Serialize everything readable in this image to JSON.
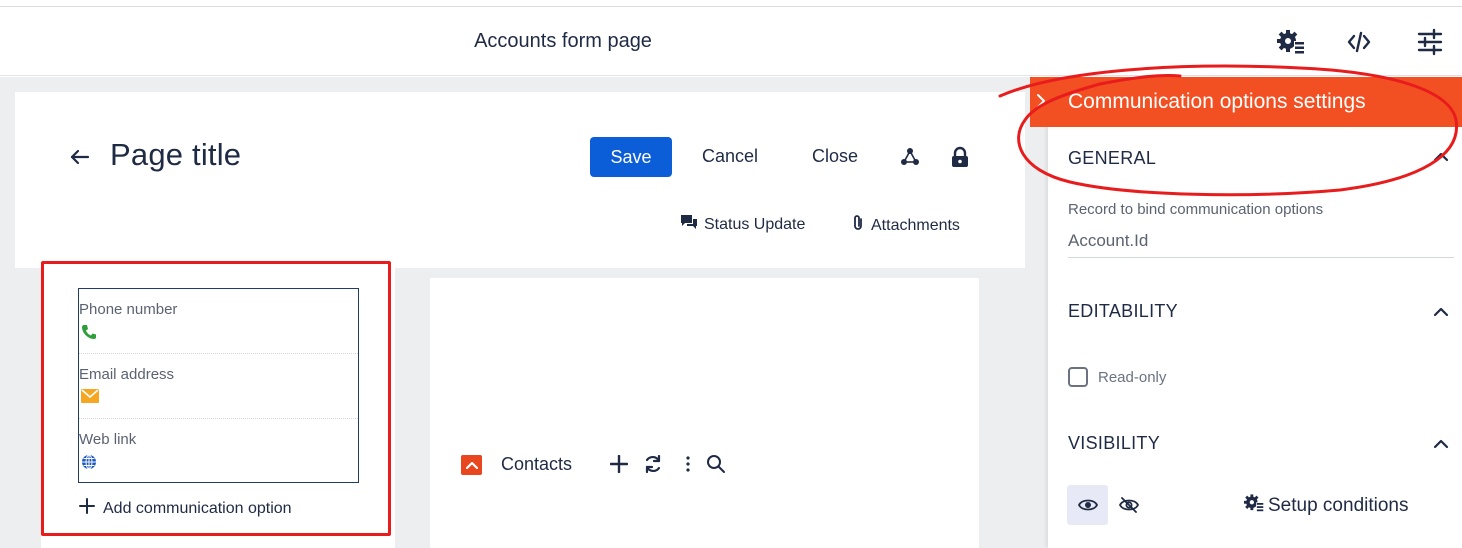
{
  "designer": {
    "title": "Accounts form page",
    "toolbar_icons": [
      "settings-gear-icon",
      "source-code-icon",
      "sliders-icon"
    ]
  },
  "header": {
    "title": "Page title",
    "save_label": "Save",
    "cancel_label": "Cancel",
    "close_label": "Close",
    "status_update_label": "Status Update",
    "attachments_label": "Attachments"
  },
  "communication_options": {
    "items": [
      {
        "label": "Phone number",
        "icon": "phone-icon"
      },
      {
        "label": "Email address",
        "icon": "email-icon"
      },
      {
        "label": "Web link",
        "icon": "globe-icon"
      }
    ],
    "add_label": "Add communication option"
  },
  "detail": {
    "title": "Contacts"
  },
  "panel": {
    "title": "Communication options settings",
    "general": {
      "title": "GENERAL",
      "field_label": "Record to bind communication options",
      "field_value": "Account.Id"
    },
    "editability": {
      "title": "EDITABILITY",
      "readonly_label": "Read-only"
    },
    "visibility": {
      "title": "VISIBILITY",
      "setup_label": "Setup conditions"
    }
  },
  "colors": {
    "accent": "#0b5ed7",
    "panel_header": "#f25022",
    "annotation": "#e81c1c",
    "phone": "#2e9e3a",
    "email": "#f5a623",
    "globe": "#1a56c4"
  }
}
